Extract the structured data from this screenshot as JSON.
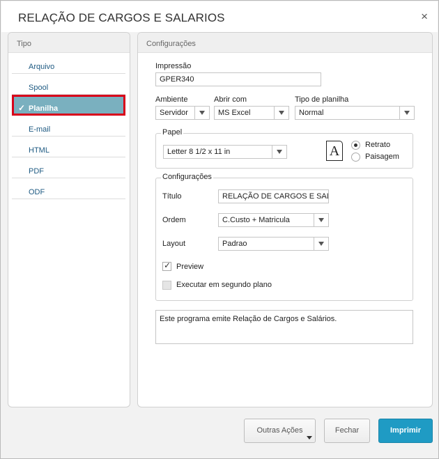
{
  "dialog": {
    "title": "RELAÇÃO DE CARGOS E SALARIOS",
    "close_label": "×"
  },
  "left_panel": {
    "heading": "Tipo",
    "items": [
      {
        "label": "Arquivo",
        "active": false
      },
      {
        "label": "Spool",
        "active": false
      },
      {
        "label": "Planilha",
        "active": true
      },
      {
        "label": "E-mail",
        "active": false
      },
      {
        "label": "HTML",
        "active": false
      },
      {
        "label": "PDF",
        "active": false
      },
      {
        "label": "ODF",
        "active": false
      }
    ],
    "check_glyph": "✓"
  },
  "right_panel": {
    "heading": "Configurações",
    "impressao": {
      "label": "Impressão",
      "value": "GPER340"
    },
    "ambiente": {
      "label": "Ambiente",
      "value": "Servidor"
    },
    "abrir_com": {
      "label": "Abrir com",
      "value": "MS Excel"
    },
    "tipo_planilha": {
      "label": "Tipo de planilha",
      "value": "Normal"
    },
    "papel": {
      "legend": "Papel",
      "size_value": "Letter 8 1/2 x 11 in",
      "page_icon_letter": "A",
      "orientation": [
        {
          "label": "Retrato",
          "selected": true
        },
        {
          "label": "Paisagem",
          "selected": false
        }
      ]
    },
    "config": {
      "legend": "Configurações",
      "titulo": {
        "label": "Título",
        "value": "RELAÇÃO DE CARGOS E SALA"
      },
      "ordem": {
        "label": "Ordem",
        "value": "C.Custo + Matricula"
      },
      "layout": {
        "label": "Layout",
        "value": "Padrao"
      },
      "preview": {
        "label": "Preview",
        "checked": true
      },
      "segundo_plano": {
        "label": "Executar em segundo plano",
        "checked": false
      }
    },
    "description": "Este programa emite Relação de Cargos e Salários."
  },
  "footer": {
    "outras_acoes": "Outras Ações",
    "fechar": "Fechar",
    "imprimir": "Imprimir"
  },
  "colors": {
    "accent": "#1f9bc4",
    "active_item": "#7ab0bf",
    "highlight_border": "#d8001a",
    "link": "#1e5a82"
  }
}
